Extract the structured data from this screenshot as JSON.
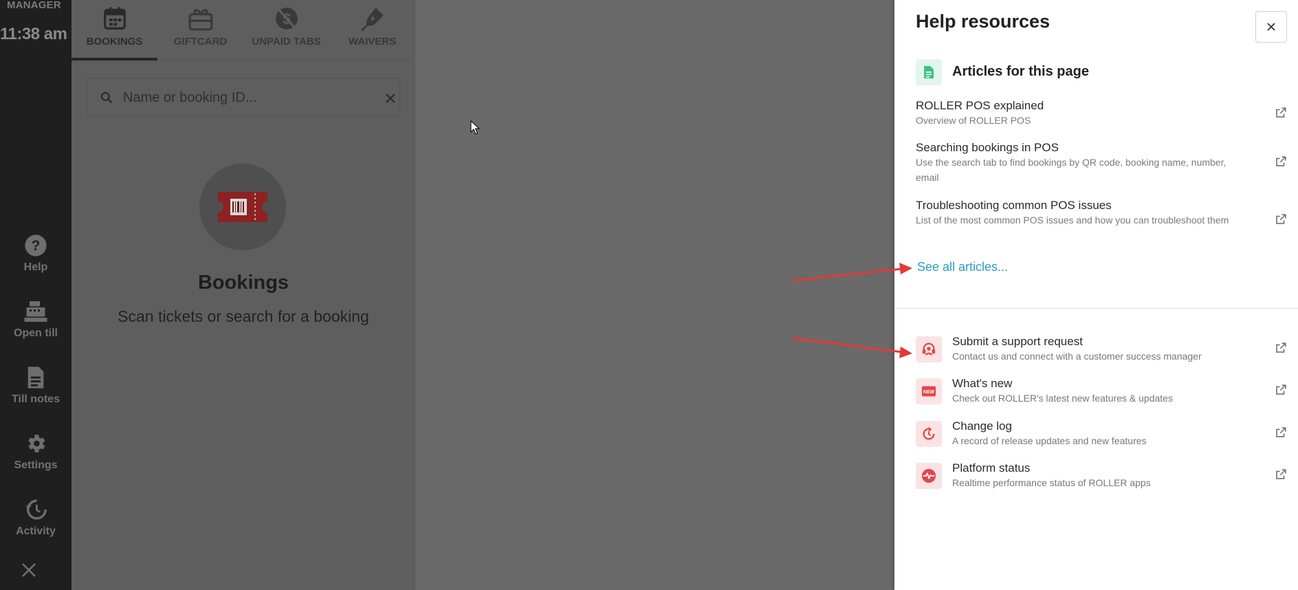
{
  "sidebar": {
    "role": "MANAGER",
    "time": "11:38 am",
    "items": [
      {
        "label": "Help",
        "icon": "help-circle-icon"
      },
      {
        "label": "Open till",
        "icon": "cash-register-icon"
      },
      {
        "label": "Till notes",
        "icon": "document-icon"
      },
      {
        "label": "Settings",
        "icon": "gear-icon"
      },
      {
        "label": "Activity",
        "icon": "history-icon"
      }
    ],
    "close_icon": "close-icon"
  },
  "tabs": [
    {
      "label": "BOOKINGS",
      "icon": "calendar-icon",
      "active": true
    },
    {
      "label": "GIFTCARD",
      "icon": "gift-card-icon",
      "active": false
    },
    {
      "label": "UNPAID TABS",
      "icon": "no-money-icon",
      "active": false
    },
    {
      "label": "WAIVERS",
      "icon": "pen-icon",
      "active": false
    }
  ],
  "search": {
    "placeholder": "Name or booking ID..."
  },
  "empty_state": {
    "title": "Bookings",
    "subtitle": "Scan tickets or search for a booking",
    "icon": "ticket-icon"
  },
  "help": {
    "title": "Help resources",
    "section_title": "Articles for this page",
    "articles": [
      {
        "title": "ROLLER POS explained",
        "desc": "Overview of ROLLER POS"
      },
      {
        "title": "Searching bookings in POS",
        "desc": "Use the search tab to find bookings by QR code, booking name, number, email"
      },
      {
        "title": "Troubleshooting common POS issues",
        "desc": "List of the most common POS issues and how you can troubleshoot them"
      }
    ],
    "see_all": "See all articles...",
    "resources": [
      {
        "title": "Submit a support request",
        "desc": "Contact us and connect with a customer success manager",
        "icon": "headset-icon"
      },
      {
        "title": "What's new",
        "desc": "Check out ROLLER's latest new features & updates",
        "icon": "new-badge-icon"
      },
      {
        "title": "Change log",
        "desc": "A record of release updates and new features",
        "icon": "refresh-icon"
      },
      {
        "title": "Platform status",
        "desc": "Realtime performance status of ROLLER apps",
        "icon": "pulse-icon"
      }
    ]
  },
  "colors": {
    "accent_link": "#2a9ec0",
    "resource_red": "#e0484d",
    "article_green": "#3cc287",
    "annotation_arrow": "#e53935"
  }
}
